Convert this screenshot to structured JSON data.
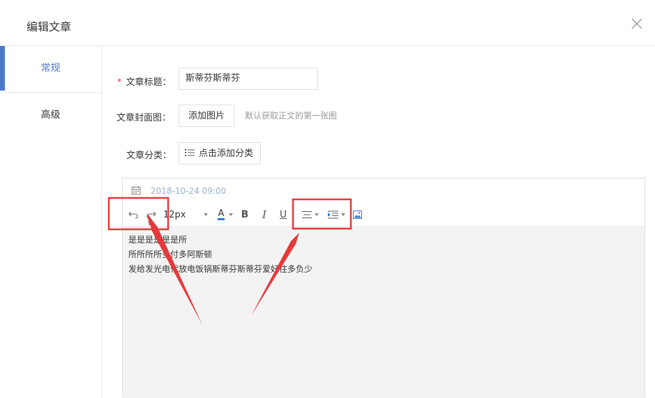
{
  "modal": {
    "title": "编辑文章"
  },
  "sidebar": {
    "items": [
      {
        "label": "常规"
      },
      {
        "label": "高级"
      }
    ]
  },
  "form": {
    "title_label": "文章标题：",
    "title_required_mark": "*",
    "title_value": "斯蒂芬斯蒂芬",
    "cover_label": "文章封面图：",
    "cover_button": "添加图片",
    "cover_hint": "默认获取正文的第一张图",
    "category_label": "文章分类：",
    "category_button": "点击添加分类"
  },
  "editor": {
    "date": "2018-10-24 09:00",
    "toolbar": {
      "font_size": "12px",
      "font_color_letter": "A",
      "bold": "B",
      "italic": "I",
      "underline": "U"
    },
    "lines": [
      "是是是是是是所",
      "所所所所多付多阿斯顿",
      "发给发光电代放电饭锅斯蒂芬斯蒂芬爱好往多负少"
    ]
  },
  "colors": {
    "accent": "#4f79c8",
    "annotation": "#e5393b"
  }
}
